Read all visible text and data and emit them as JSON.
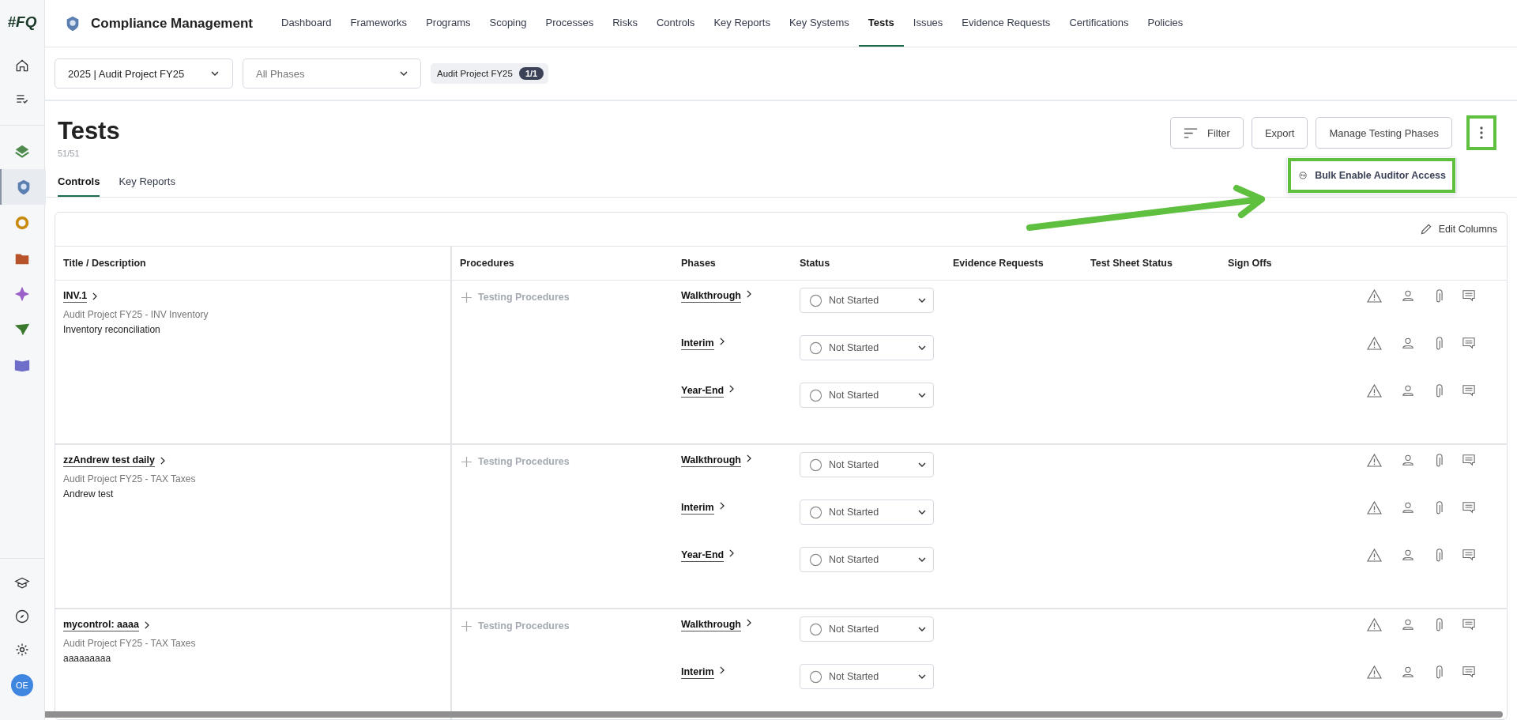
{
  "app": {
    "logo": "#FQ",
    "module_title": "Compliance Management"
  },
  "nav": [
    {
      "label": "Dashboard",
      "selected": false
    },
    {
      "label": "Frameworks",
      "selected": false
    },
    {
      "label": "Programs",
      "selected": false
    },
    {
      "label": "Scoping",
      "selected": false
    },
    {
      "label": "Processes",
      "selected": false
    },
    {
      "label": "Risks",
      "selected": false
    },
    {
      "label": "Controls",
      "selected": false
    },
    {
      "label": "Key Reports",
      "selected": false
    },
    {
      "label": "Key Systems",
      "selected": false
    },
    {
      "label": "Tests",
      "selected": true
    },
    {
      "label": "Issues",
      "selected": false
    },
    {
      "label": "Evidence Requests",
      "selected": false
    },
    {
      "label": "Certifications",
      "selected": false
    },
    {
      "label": "Policies",
      "selected": false
    }
  ],
  "sidebar": {
    "apps": [
      {
        "kind": "layers",
        "selected": false
      },
      {
        "kind": "badge",
        "selected": true
      },
      {
        "kind": "ring",
        "selected": false
      },
      {
        "kind": "folder",
        "selected": false
      },
      {
        "kind": "sparkle",
        "selected": false
      },
      {
        "kind": "plane",
        "selected": false
      },
      {
        "kind": "book",
        "selected": false
      }
    ],
    "avatar": "OE"
  },
  "filters": {
    "project": "2025 | Audit Project FY25",
    "phases": {
      "placeholder": "All Phases"
    },
    "chip": {
      "label": "Audit Project FY25",
      "count": "1/1"
    }
  },
  "page": {
    "title": "Tests",
    "count": "51/51",
    "actions": [
      {
        "kind": "filter",
        "label": "Filter"
      },
      {
        "kind": "plain",
        "label": "Export"
      },
      {
        "kind": "plain",
        "label": "Manage Testing Phases"
      }
    ],
    "menu": {
      "items": [
        "Bulk Enable Auditor Access"
      ]
    }
  },
  "tabs": [
    {
      "label": "Controls",
      "selected": true
    },
    {
      "label": "Key Reports",
      "selected": false
    }
  ],
  "table": {
    "edit_columns": "Edit Columns",
    "columns": [
      "Title / Description",
      "Procedures",
      "Phases",
      "Status",
      "Evidence Requests",
      "Test Sheet Status",
      "Sign Offs"
    ],
    "rows": [
      {
        "title": "INV.1",
        "subtitle": "Audit Project FY25 - INV Inventory",
        "description": "Inventory reconciliation",
        "procedures": "Testing Procedures",
        "phases": [
          {
            "name": "Walkthrough",
            "status": "Not Started"
          },
          {
            "name": "Interim",
            "status": "Not Started"
          },
          {
            "name": "Year-End",
            "status": "Not Started"
          }
        ]
      },
      {
        "title": "zzAndrew test daily",
        "subtitle": "Audit Project FY25 - TAX Taxes",
        "description": "Andrew test",
        "procedures": "Testing Procedures",
        "phases": [
          {
            "name": "Walkthrough",
            "status": "Not Started"
          },
          {
            "name": "Interim",
            "status": "Not Started"
          },
          {
            "name": "Year-End",
            "status": "Not Started"
          }
        ]
      },
      {
        "title": "mycontrol: aaaa",
        "subtitle": "Audit Project FY25 - TAX Taxes",
        "description": "aaaaaaaaa",
        "procedures": "Testing Procedures",
        "phases": [
          {
            "name": "Walkthrough",
            "status": "Not Started"
          },
          {
            "name": "Interim",
            "status": "Not Started"
          }
        ]
      }
    ]
  }
}
